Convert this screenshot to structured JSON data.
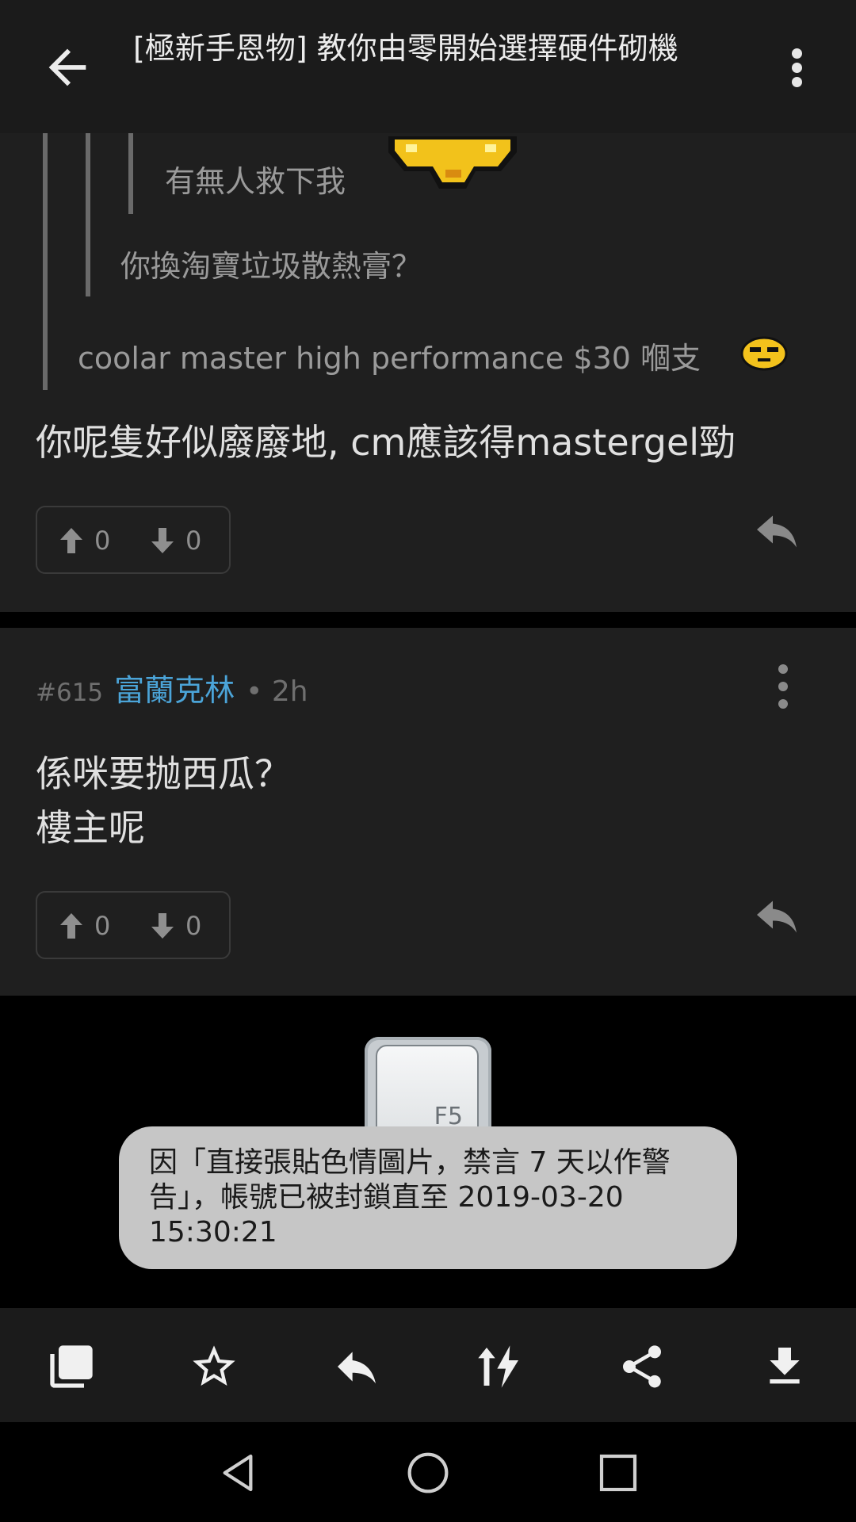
{
  "header": {
    "title": "[極新手恩物] 教你由零開始選擇硬件砌機"
  },
  "post1": {
    "nested_quote_text": "有無人救下我",
    "quote_text": "你換淘寶垃圾散熱膏？",
    "outer_quote_text": "coolar master high performance $30 嗰支",
    "body": "你呢隻好似廢廢地, cm應該得mastergel勁",
    "upvotes": "0",
    "downvotes": "0"
  },
  "post2": {
    "floor": "#615",
    "author": "富蘭克林",
    "time": "• 2h",
    "body_line1": "係咪要抛西瓜？",
    "body_line2": "樓主呢",
    "upvotes": "0",
    "downvotes": "0"
  },
  "f5_key": {
    "label": "F5"
  },
  "toast": {
    "message": "因「直接張貼色情圖片，禁言 7 天以作警告」，帳號已被封鎖直至 2019-03-20 15:30:21"
  },
  "bottom_toolbar": {
    "icons": [
      "gallery-icon",
      "star-icon",
      "reply-icon",
      "sort-flash-icon",
      "share-icon",
      "download-icon"
    ]
  },
  "system_nav": {
    "icons": [
      "nav-back-icon",
      "nav-home-icon",
      "nav-recents-icon"
    ]
  },
  "colors": {
    "author": "#4ba4d8",
    "background": "#1f1f1f",
    "toast_bg": "#c6c6c6"
  }
}
